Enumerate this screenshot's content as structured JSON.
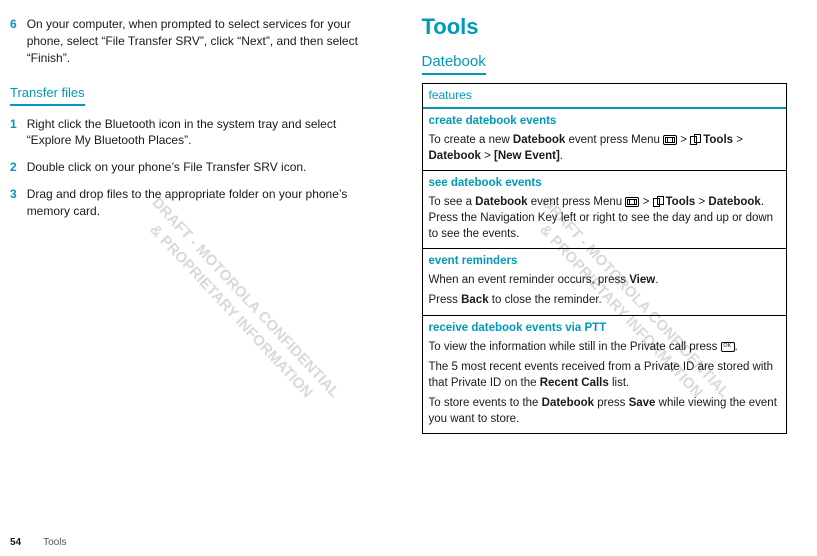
{
  "watermark": "DRAFT - MOTOROLA CONFIDENTIAL\n& PROPRIETARY INFORMATION",
  "left": {
    "step6": {
      "num": "6",
      "text": "On your computer, when prompted to select services for your phone, select “File Transfer SRV”, click “Next”, and then select “Finish”."
    },
    "transferFiles": {
      "heading": "Transfer files",
      "t1": {
        "num": "1",
        "text": "Right click the Bluetooth icon in the system tray and select “Explore My Bluetooth Places”."
      },
      "t2": {
        "num": "2",
        "text": "Double click on your phone’s File Transfer SRV icon."
      },
      "t3": {
        "num": "3",
        "text": "Drag and drop files to the appropriate folder on your phone’s memory card."
      }
    }
  },
  "right": {
    "title": "Tools",
    "subtitle": "Datebook",
    "featuresHeader": "features",
    "rows": {
      "create": {
        "title": "create datebook events",
        "p1a": "To create a new ",
        "datebook": "Datebook",
        "p1b": " event press Menu ",
        "gt1": " > ",
        "tools": "Tools",
        "gt2": " > ",
        "datebook2": "Datebook",
        "gt3": " > ",
        "newevent": "[New Event]",
        "p1c": "."
      },
      "see": {
        "title": "see datebook events",
        "p1a": "To see a ",
        "datebook": "Datebook",
        "p1b": " event press Menu ",
        "gt1": " > ",
        "tools": "Tools",
        "gt2": " > ",
        "datebook2": "Datebook",
        "p1c": ". Press the Navigation Key left or right to see the day and up or down to see the events."
      },
      "reminders": {
        "title": "event reminders",
        "p1a": "When an event reminder occurs, press ",
        "view": "View",
        "p1b": ".",
        "p2a": "Press ",
        "back": "Back",
        "p2b": " to close the reminder."
      },
      "ptt": {
        "title": "receive datebook events via PTT",
        "p1a": "To view the information while still in the Private call press ",
        "p1b": ".",
        "p2a": "The 5 most recent events received from a Private ID are stored with that Private ID on the ",
        "recentcalls": "Recent Calls",
        "p2b": " list.",
        "p3a": "To store events to the ",
        "datebook": "Datebook",
        "p3b": " press ",
        "save": "Save",
        "p3c": " while viewing the event you want to store."
      }
    }
  },
  "footer": {
    "page": "54",
    "section": "Tools"
  }
}
